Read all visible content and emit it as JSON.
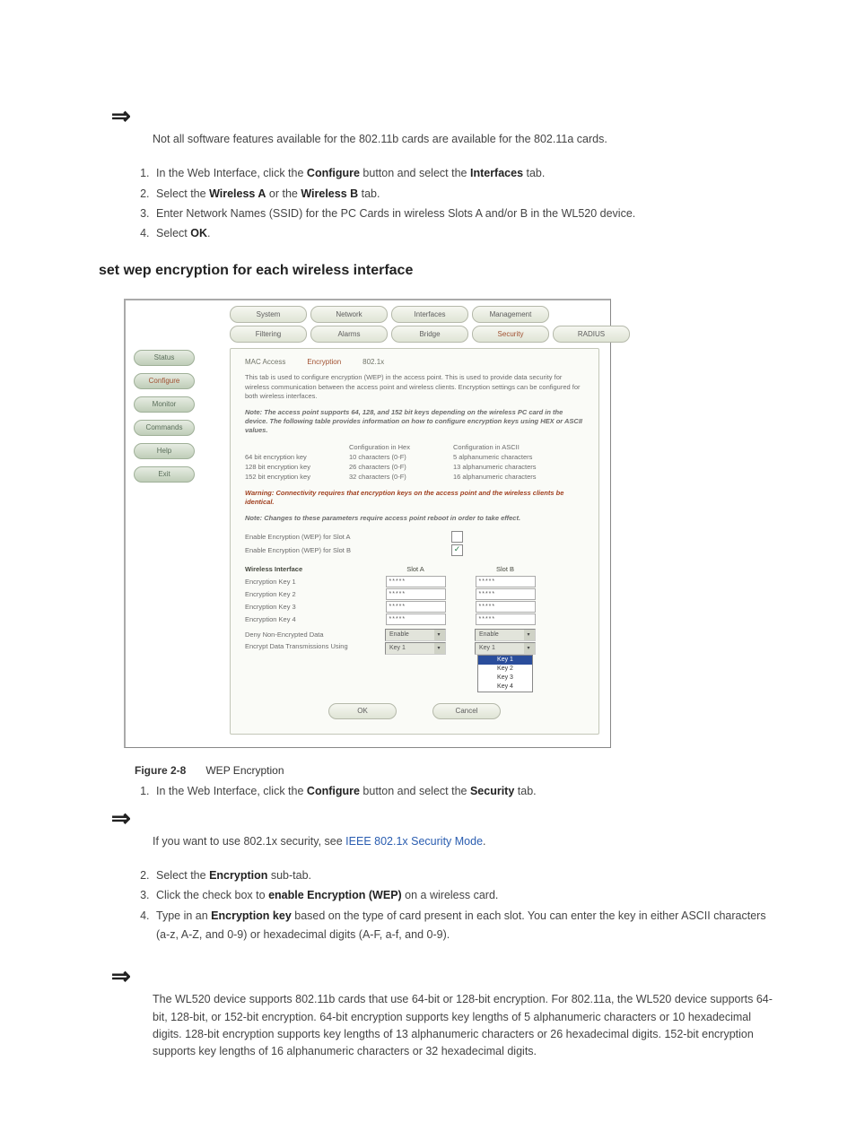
{
  "notes": {
    "n1_prefix": "Not all software features available for the ",
    "n1_cardb": "802.11b",
    "n1_mid": " cards are available for the ",
    "n1_carda": "802.11a",
    "n1_suffix": " cards.",
    "n2_prefix": "If you want to use 802.1x security, see ",
    "n2_link": "IEEE 802.1x Security Mode",
    "n2_suffix": ".",
    "n3": "The WL520 device supports 802.11b cards that use 64-bit or 128-bit encryption. For 802.11a, the WL520 device supports 64-bit, 128-bit, or 152-bit encryption. 64-bit encryption supports key lengths of 5 alphanumeric characters or 10 hexadecimal digits. 128-bit encryption supports key lengths of 13 alphanumeric characters or 26 hexadecimal digits. 152-bit encryption supports key lengths of 16 alphanumeric characters or 32 hexadecimal digits."
  },
  "steps1": {
    "s1_a": "In the Web Interface, click the ",
    "s1_b": "Configure",
    "s1_c": " button and select the ",
    "s1_d": "Interfaces",
    "s1_e": " tab.",
    "s2_a": "Select the ",
    "s2_b": "Wireless A",
    "s2_c": " or the ",
    "s2_d": "Wireless B",
    "s2_e": " tab.",
    "s3": "Enter Network Names (SSID) for the PC Cards in wireless Slots A and/or B in the WL520 device.",
    "s4_a": "Select ",
    "s4_b": "OK",
    "s4_c": "."
  },
  "steps2": {
    "s1_a": "In the Web Interface, click the ",
    "s1_b": "Configure",
    "s1_c": " button and select the ",
    "s1_d": "Security",
    "s1_e": " tab.",
    "s2_a": "Select the ",
    "s2_b": "Encryption",
    "s2_c": " sub-tab.",
    "s3_a": "Click the check box to ",
    "s3_b": "enable Encryption (WEP)",
    "s3_c": " on a wireless card.",
    "s4_a": "Type in an ",
    "s4_b": "Encryption key",
    "s4_c": " based on the type of card present in each slot. You can enter the key in either ASCII characters (a-z, A-Z, and 0-9) or hexadecimal digits (A-F, a-f, and 0-9)."
  },
  "section_heading": "set wep encryption for each wireless interface",
  "figure": {
    "label": "Figure 2-8",
    "title": "WEP Encryption"
  },
  "shot": {
    "sidebar": [
      "Status",
      "Configure",
      "Monitor",
      "Commands",
      "Help",
      "Exit"
    ],
    "sidebar_active_index": 1,
    "tabs1": [
      "System",
      "Network",
      "Interfaces",
      "Management"
    ],
    "tabs2": [
      "Filtering",
      "Alarms",
      "Bridge",
      "Security",
      "RADIUS"
    ],
    "tabs2_active_index": 3,
    "subtabs": [
      "MAC Access",
      "Encryption",
      "802.1x"
    ],
    "subtabs_active_index": 1,
    "intro1": "This tab is used to configure encryption (WEP) in the access point. This is used to provide data security for wireless communication between the access point and wireless clients. Encryption settings can be configured for both wireless interfaces.",
    "intro2": "Note: The access point supports 64, 128, and 152 bit keys depending on the wireless PC card in the device. The following table provides information on how to configure encryption keys using HEX or ASCII values.",
    "keytbl": {
      "h1": "",
      "h2": "Configuration in Hex",
      "h3": "Configuration in ASCII",
      "rows": [
        [
          "64 bit encryption key",
          "10 characters (0-F)",
          "5 alphanumeric characters"
        ],
        [
          "128 bit encryption key",
          "26 characters (0-F)",
          "13 alphanumeric characters"
        ],
        [
          "152 bit encryption key",
          "32 characters (0-F)",
          "16 alphanumeric characters"
        ]
      ]
    },
    "warn": "Warning: Connectivity requires that encryption keys on the access point and the wireless clients be identical.",
    "reboot": "Note: Changes to these parameters require access point reboot in order to take effect.",
    "enableA": "Enable Encryption (WEP) for Slot A",
    "enableB": "Enable Encryption (WEP) for Slot B",
    "wi_hdr": {
      "c1": "Wireless Interface",
      "c2": "Slot A",
      "c3": "Slot B"
    },
    "wi_rows": [
      "Encryption Key 1",
      "Encryption Key 2",
      "Encryption Key 3",
      "Encryption Key 4"
    ],
    "pw_mask": "*****",
    "deny_lbl": "Deny Non-Encrypted Data",
    "encr_lbl": "Encrypt Data Transmissions Using",
    "sel_enable": "Enable",
    "sel_key1": "Key 1",
    "dropdown": [
      "Key 1",
      "Key 2",
      "Key 3",
      "Key 4"
    ],
    "btn_ok": "OK",
    "btn_cancel": "Cancel"
  }
}
